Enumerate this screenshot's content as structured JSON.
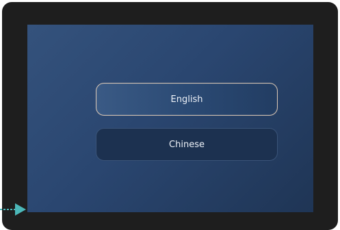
{
  "language_selection": {
    "options": [
      {
        "label": "English",
        "selected": true
      },
      {
        "label": "Chinese",
        "selected": false
      }
    ]
  },
  "colors": {
    "bezel": "#1e1e1e",
    "screen_start": "#34527c",
    "screen_end": "#1f3555",
    "selected_border": "#d9c6b3",
    "pointer_arrow": "#4cb8b9"
  },
  "pointer": {
    "icon": "pointer-arrow-icon"
  }
}
